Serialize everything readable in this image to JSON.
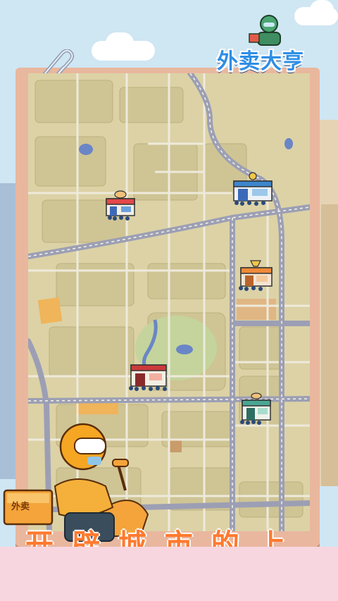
{
  "game": {
    "title": "外卖大亨",
    "box_label": "外卖",
    "slogan": "开 辟 城 市 的 上"
  },
  "map": {
    "shops": [
      {
        "name": "shop-burger",
        "awning": "#e4484a"
      },
      {
        "name": "shop-blue",
        "awning": "#3c86cc"
      },
      {
        "name": "shop-orange",
        "awning": "#f08a3a"
      },
      {
        "name": "shop-red",
        "awning": "#cc3a3a"
      },
      {
        "name": "shop-teal",
        "awning": "#4aa692"
      }
    ]
  },
  "colors": {
    "sky": "#cfe6f3",
    "board": "#e9b79e",
    "map_land": "#dcd2a6",
    "map_road": "#9c9fb4",
    "map_block": "#c9bf8e",
    "rider_jacket": "#f4a43a",
    "helmet": "#f5a623",
    "slogan": "#ff7a2f",
    "logo": "#2e8ee6"
  }
}
